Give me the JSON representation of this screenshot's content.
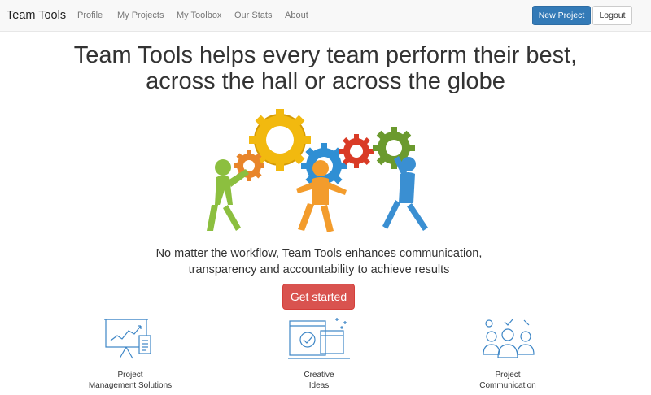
{
  "nav": {
    "brand": "Team Tools",
    "links": [
      "Profile",
      "My Projects",
      "My Toolbox",
      "Our Stats",
      "About"
    ],
    "new_project": "New Project",
    "logout": "Logout"
  },
  "hero": {
    "headline_line1": "Team Tools helps every team perform their best,",
    "headline_line2": "across the hall or across the globe",
    "tagline_line1": "No matter the workflow, Team Tools enhances communication,",
    "tagline_line2": "transparency and accountability to achieve results",
    "cta": "Get started"
  },
  "features": [
    {
      "line1": "Project",
      "line2": "Management Solutions",
      "icon": "presentation-board-icon"
    },
    {
      "line1": "Creative",
      "line2": "Ideas",
      "icon": "creative-ideas-icon"
    },
    {
      "line1": "Project",
      "line2": "Communication",
      "icon": "team-communication-icon"
    }
  ],
  "colors": {
    "primary": "#337ab7",
    "danger": "#d9534f",
    "icon_blue": "#3d86c6",
    "gear_yellow": "#f2b90f",
    "gear_orange": "#e8852a",
    "gear_blue": "#2f8fd4",
    "gear_red": "#d93b26",
    "gear_green": "#6b9a2e",
    "figure_green": "#8cbf3f",
    "figure_orange": "#f39c2c",
    "figure_blue": "#3a8fd2"
  }
}
